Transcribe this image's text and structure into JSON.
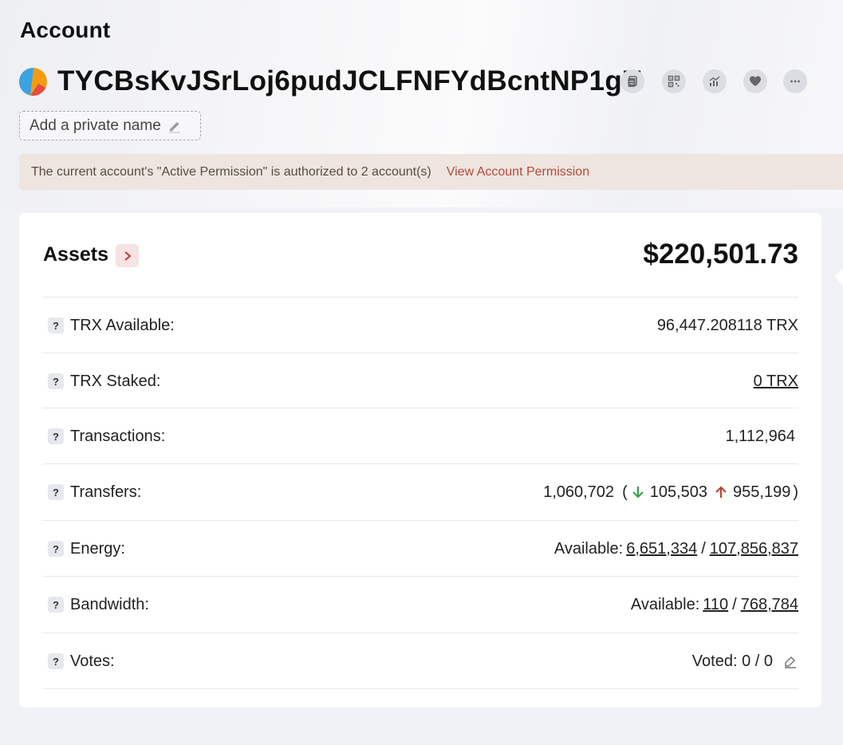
{
  "page": {
    "title": "Account"
  },
  "account": {
    "address": "TYCBsKvJSrLoj6pudJCLFNFYdBcntNP1gU",
    "private_name_placeholder": "Add a private name",
    "actions": [
      {
        "name": "copy-icon"
      },
      {
        "name": "qr-code-icon"
      },
      {
        "name": "analytics-icon"
      },
      {
        "name": "heart-icon"
      },
      {
        "name": "more-icon"
      }
    ]
  },
  "notice": {
    "text": "The current account's \"Active Permission\" is authorized to 2 account(s)",
    "link": "View Account Permission"
  },
  "assets": {
    "title": "Assets",
    "total": "$220,501.73",
    "rows": {
      "trx_available": {
        "label": "TRX Available:",
        "value": "96,447.208118 TRX"
      },
      "trx_staked": {
        "label": "TRX Staked:",
        "value": "0 TRX"
      },
      "transactions": {
        "label": "Transactions:",
        "value": "1,112,964"
      },
      "transfers": {
        "label": "Transfers:",
        "total": "1,060,702",
        "incoming": "105,503",
        "outgoing": "955,199"
      },
      "energy": {
        "label": "Energy:",
        "prefix": "Available:",
        "available": "6,651,334",
        "total": "107,856,837"
      },
      "bandwidth": {
        "label": "Bandwidth:",
        "prefix": "Available:",
        "available": "110",
        "total": "768,784"
      },
      "votes": {
        "label": "Votes:",
        "value": "Voted: 0 / 0"
      }
    }
  },
  "colors": {
    "accent_red": "#c0392b",
    "green": "#2e9e4a",
    "notice_bg": "#efe5df"
  }
}
